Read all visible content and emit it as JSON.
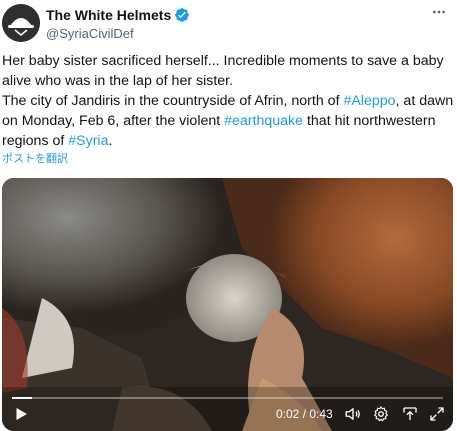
{
  "author": {
    "display_name": "The White Helmets",
    "handle": "@SyriaCivilDef",
    "verified": true,
    "avatar_icon": "white-helmets-logo",
    "verified_color": "#1d9bf0"
  },
  "tweet": {
    "line1": "Her baby sister sacrificed herself... Incredible moments to save a baby alive who was in the lap of her sister.",
    "line2_before": "The city of Jandiris in the countryside of Afrin, north of ",
    "hashtag1": "#Aleppo",
    "line2_mid": ", at dawn on Monday, Feb 6, after the violent ",
    "hashtag2": "#earthquake",
    "line2_after": " that hit northwestern regions of ",
    "hashtag3": "#Syria",
    "line2_end": ".",
    "hashtag_color": "#1d9bf0"
  },
  "translate_label": "ポストを翻訳",
  "video": {
    "current_time": "0:02",
    "separator": " / ",
    "duration": "0:43",
    "progress_fraction": 0.047
  }
}
